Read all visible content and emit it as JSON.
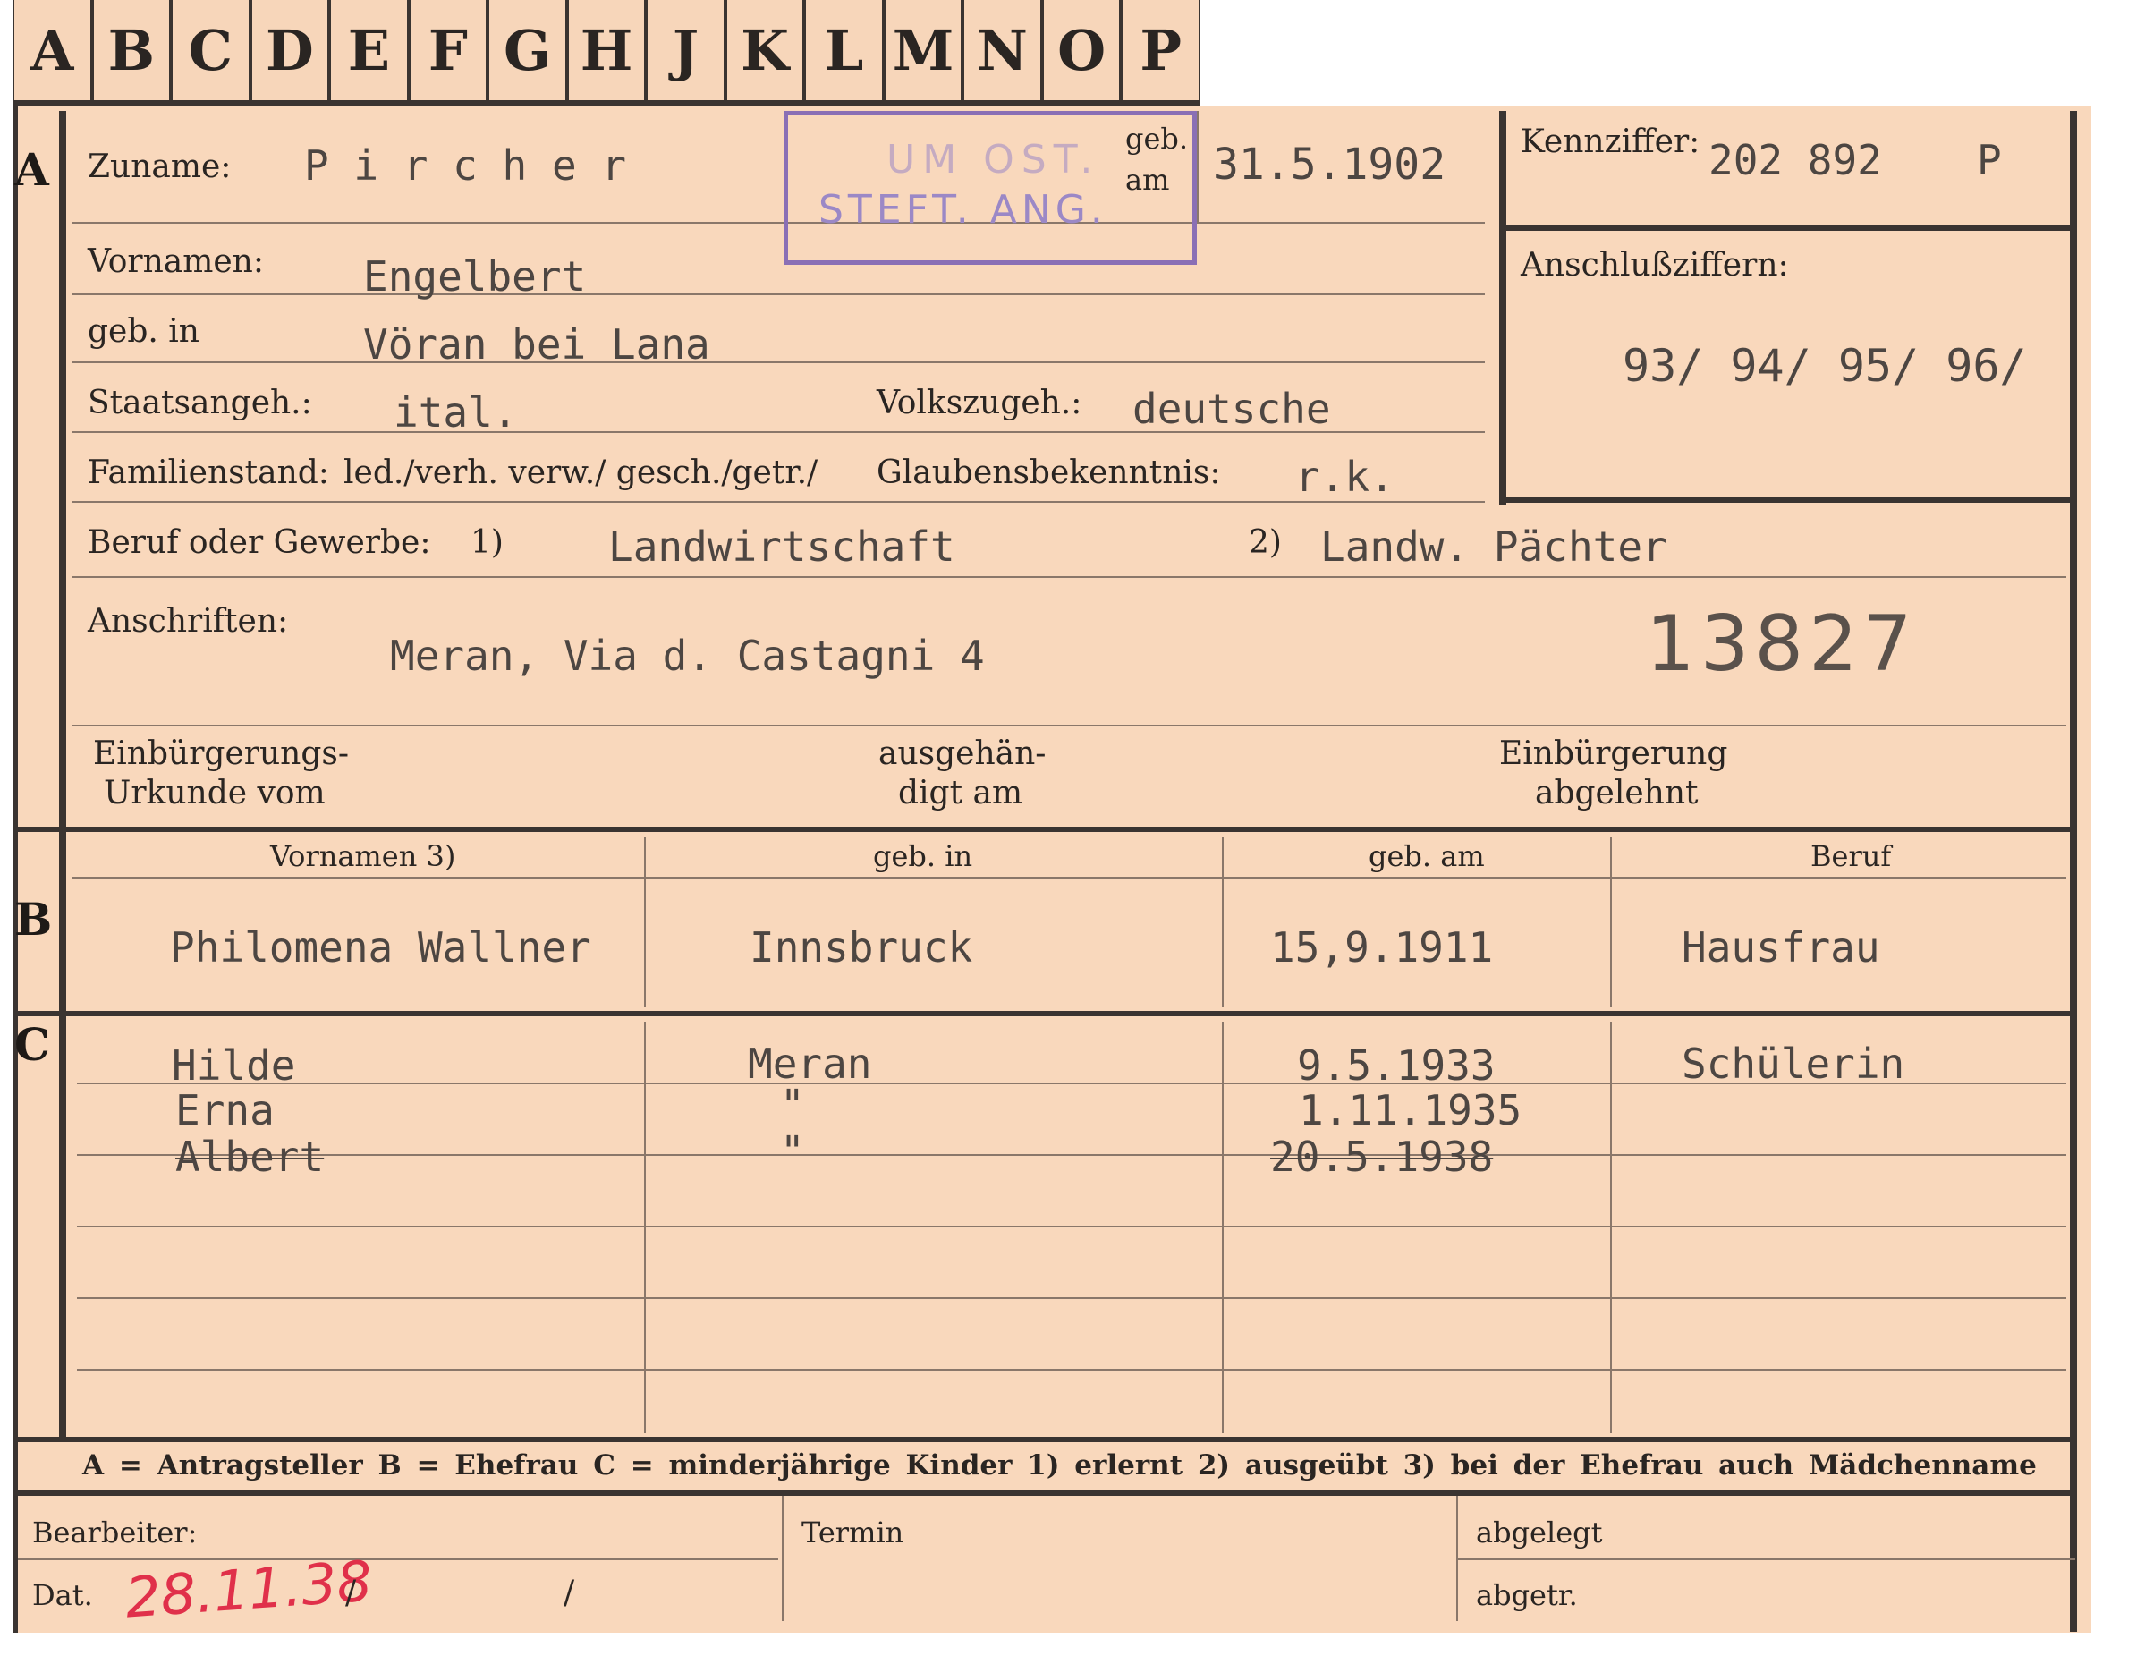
{
  "tabs": [
    "A",
    "B",
    "C",
    "D",
    "E",
    "F",
    "G",
    "H",
    "J",
    "K",
    "L",
    "M",
    "N",
    "O",
    "P"
  ],
  "sections": {
    "a": "A",
    "b": "B",
    "c": "C"
  },
  "stamp": {
    "line1": "UM OST.",
    "line2": "STEFT. ANG."
  },
  "head": {
    "surname_label": "Zuname:",
    "surname_value": "P i r c h e r",
    "dob_label_1": "geb.",
    "dob_label_2": "am",
    "dob_value": "31.5.1902",
    "kennziffer_label": "Kennziffer:",
    "kennziffer_value": "202 892",
    "kennziffer_suffix": "P",
    "anschluss_label": "Anschlußziffern:",
    "anschluss_value": "93/ 94/ 95/ 96/"
  },
  "person": {
    "vornamen_label": "Vornamen:",
    "vornamen_value": "Engelbert",
    "gebin_label": "geb. in",
    "gebin_value": "Vöran bei Lana",
    "staat_label": "Staatsangeh.:",
    "staat_value": "ital.",
    "volk_label": "Volkszugeh.:",
    "volk_value": "deutsche",
    "familie_label": "Familienstand:",
    "familie_value": "led./verh. verw./ gesch./getr./",
    "glaube_label": "Glaubensbekenntnis:",
    "glaube_value": "r.k.",
    "beruf_label": "Beruf oder Gewerbe:",
    "beruf_1_mark": "1)",
    "beruf_1_value": "Landwirtschaft",
    "beruf_2_mark": "2)",
    "beruf_2_value": "Landw. Pächter",
    "anschrift_label": "Anschriften:",
    "anschrift_value": "Meran, Via d. Castagni 4",
    "number": "13827",
    "einb_label_1": "Einbürgerungs-",
    "einb_label_2": "Urkunde vom",
    "ausg_label_1": "ausgehän-",
    "ausg_label_2": "digt am",
    "abgel_label_1": "Einbürgerung",
    "abgel_label_2": "abgelehnt"
  },
  "wife": {
    "col_vornamen": "Vornamen 3)",
    "col_gebin": "geb. in",
    "col_gebam": "geb. am",
    "col_beruf": "Beruf",
    "name": "Philomena Wallner",
    "place": "Innsbruck",
    "date": "15,9.1911",
    "job": "Hausfrau"
  },
  "children": [
    {
      "name": "Hilde",
      "place": "Meran",
      "date": "9.5.1933",
      "job": "Schülerin"
    },
    {
      "name": "Erna",
      "place": "\"",
      "date": "1.11.1935",
      "job": ""
    },
    {
      "name": "Albert",
      "place": "\"",
      "date": "20.5.1938",
      "job": ""
    }
  ],
  "legend": "A = Antragsteller   B = Ehefrau   C = minderjährige Kinder   1) erlernt   2) ausgeübt   3) bei der Ehefrau auch Mädchenname",
  "footer": {
    "bearbeiter": "Bearbeiter:",
    "dat": "Dat.",
    "date_handwritten": "28.11.38",
    "slash1": "/",
    "slash2": "/",
    "termin": "Termin",
    "abgelegt": "abgelegt",
    "abgetr": "abgetr."
  }
}
